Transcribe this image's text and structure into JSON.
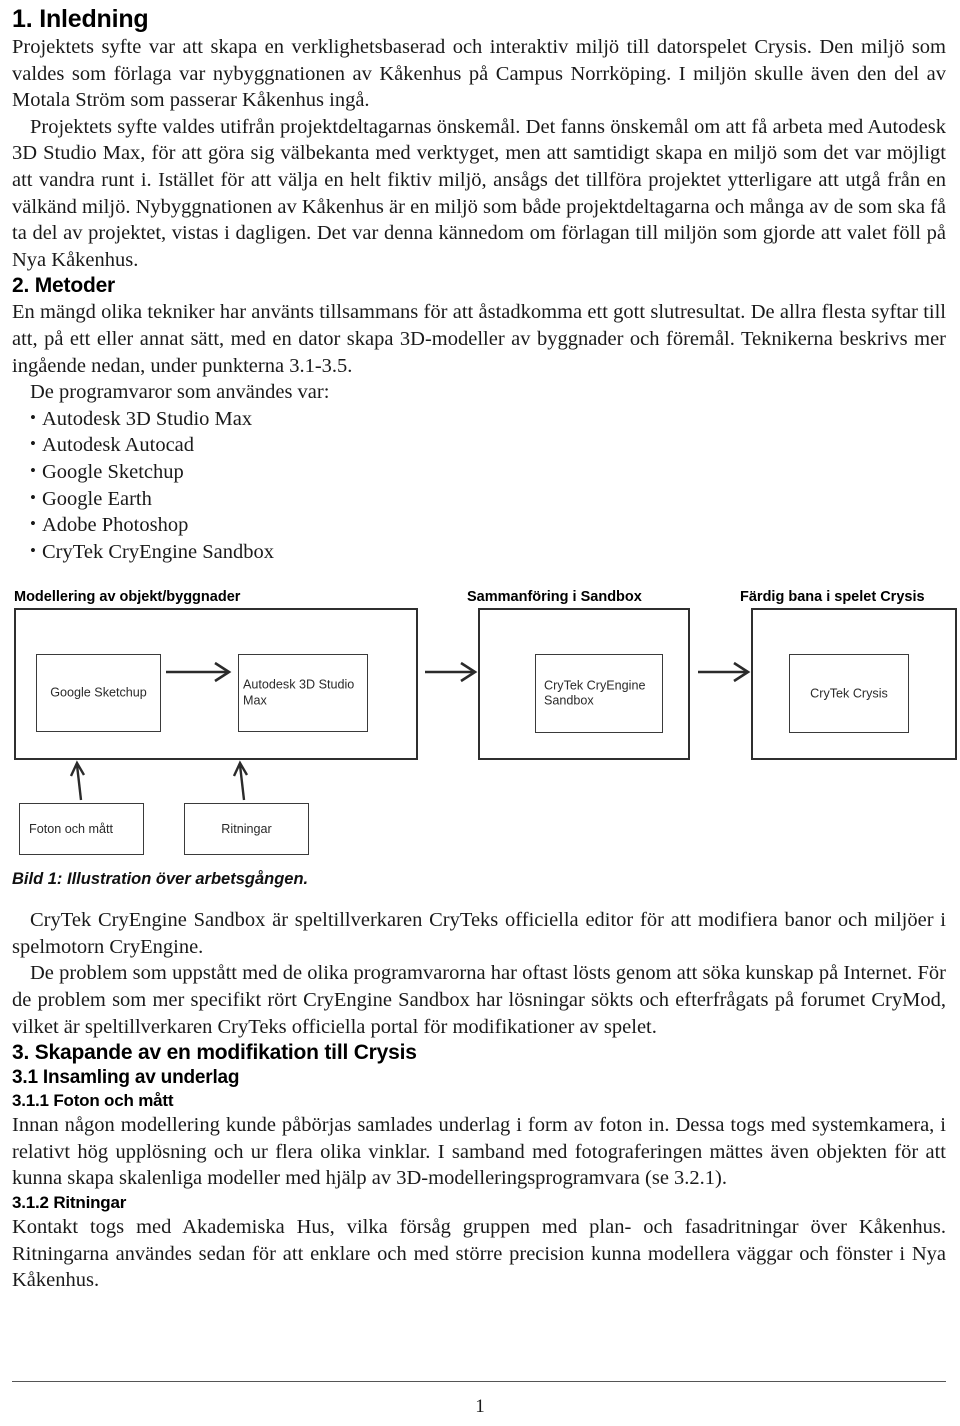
{
  "sections": {
    "h_inledning": "1. Inledning",
    "h_metoder": "2. Metoder",
    "h_skapande": "3. Skapande av en modifikation till Crysis",
    "h_insamling": "3.1 Insamling av underlag",
    "h_foton": "3.1.1 Foton och mått",
    "h_ritningar": "3.1.2 Ritningar"
  },
  "paragraphs": {
    "p1": "Projektets syfte var att skapa en verklighetsbaserad och interaktiv miljö till datorspelet Crysis. Den miljö som valdes som förlaga var nybyggnationen av Kåkenhus på Campus Norrköping. I miljön skulle även den del av Motala Ström som passerar Kåkenhus ingå.",
    "p2": "Projektets syfte valdes utifrån projektdeltagarnas önskemål. Det fanns önskemål om att få arbeta med Autodesk 3D Studio Max, för att göra sig välbekanta med verktyget, men att samtidigt skapa en miljö som det var möjligt att vandra runt i. Istället för att välja en helt fiktiv miljö, ansågs det tillföra projektet ytterligare att utgå från en välkänd miljö. Nybyggnationen av Kåkenhus är en miljö som både projektdeltagarna och många av de som ska få ta del av projektet, vistas i dagligen. Det var denna kännedom om förlagan till miljön som gjorde att valet föll på Nya Kåkenhus.",
    "p3": "En mängd olika tekniker har använts tillsammans för att åstadkomma ett gott slutresultat. De allra flesta syftar till att, på ett eller annat sätt, med en dator skapa 3D-modeller av byggnader och föremål. Teknikerna beskrivs mer ingående nedan, under punkterna 3.1-3.5.",
    "prog_lead": "De programvaror som användes var:",
    "p4": "CryTek CryEngine Sandbox är speltillverkaren CryTeks officiella editor för att modifiera banor och miljöer i spelmotorn CryEngine.",
    "p5": "De problem som uppstått med de olika programvarorna har oftast lösts genom att söka kunskap på Internet. För de problem som mer specifikt rört CryEngine Sandbox har lösningar sökts och efterfrågats på forumet CryMod, vilket är speltillverkaren CryTeks officiella portal för modifikationer av spelet.",
    "p6": "Innan någon modellering kunde påbörjas samlades underlag i form av foton in. Dessa togs med systemkamera, i relativt hög upplösning och ur flera olika vinklar. I samband med fotograferingen mättes även objekten för att kunna skapa skalenliga modeller med hjälp av 3D-modelleringsprogramvara (se 3.2.1).",
    "p7": "Kontakt togs med Akademiska Hus, vilka försåg gruppen med plan- och fasadritningar över Kåkenhus. Ritningarna användes sedan för att enklare och med större precision kunna modellera väggar och fönster i Nya Kåkenhus."
  },
  "program_list": [
    "Autodesk 3D Studio Max",
    "Autodesk Autocad",
    "Google Sketchup",
    "Google Earth",
    "Adobe Photoshop",
    "CryTek CryEngine Sandbox"
  ],
  "figure": {
    "panel_labels": {
      "modellering": "Modellering av objekt/byggnader",
      "sammanforing": "Sammanföring i Sandbox",
      "fardig": "Färdig bana i spelet Crysis"
    },
    "boxes": {
      "sketchup": "Google Sketchup",
      "maxstudio": "Autodesk 3D Studio Max",
      "sandbox": "CryTek CryEngine\nSandbox",
      "crysis": "CryTek Crysis",
      "foton": "Foton och mått",
      "ritningar": "Ritningar"
    },
    "caption": "Bild 1: Illustration över arbetsgången."
  },
  "footer": {
    "page_number": "1"
  },
  "colors": {
    "text": "#1a1a1a",
    "heading": "#000000",
    "box_border": "#2f2f2f",
    "inner_border": "#3a3a3a",
    "rule": "#555555"
  }
}
